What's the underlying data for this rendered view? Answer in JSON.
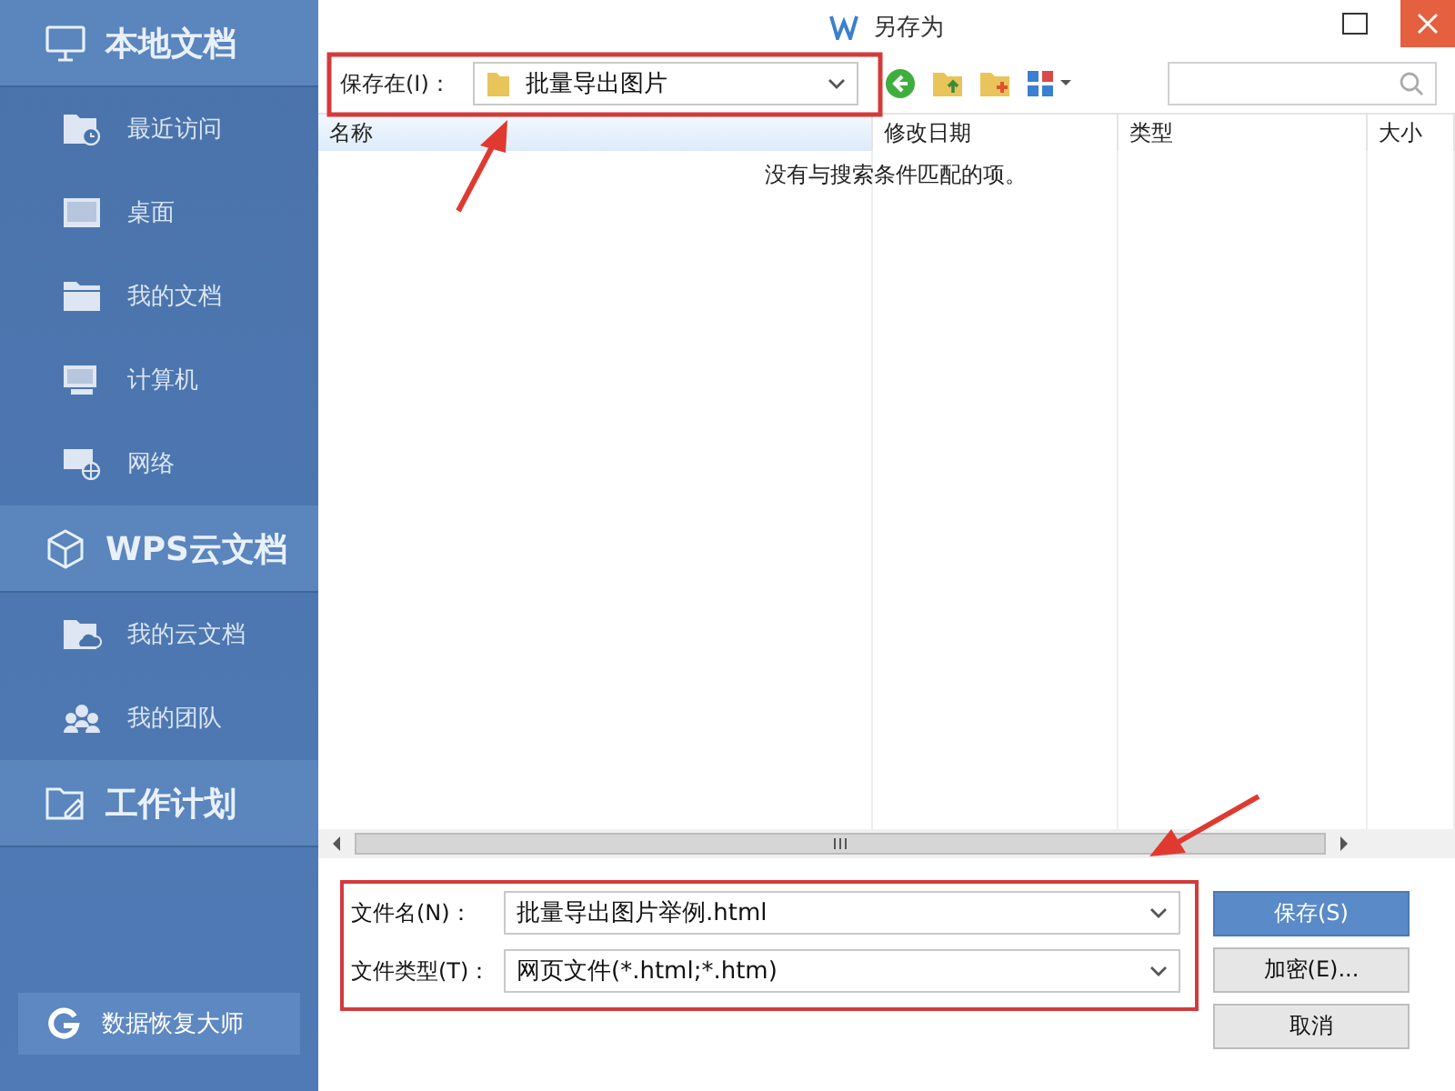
{
  "sidebar": {
    "sections": [
      {
        "title": "本地文档",
        "items": [
          {
            "label": "最近访问"
          },
          {
            "label": "桌面"
          },
          {
            "label": "我的文档"
          },
          {
            "label": "计算机"
          },
          {
            "label": "网络"
          }
        ]
      },
      {
        "title": "WPS云文档",
        "items": [
          {
            "label": "我的云文档"
          },
          {
            "label": "我的团队"
          }
        ]
      },
      {
        "title": "工作计划"
      }
    ],
    "footer_button": "数据恢复大师"
  },
  "window": {
    "title": "另存为"
  },
  "toolbar": {
    "location_label": "保存在(I)：",
    "location_value": "批量导出图片"
  },
  "table": {
    "columns": [
      "名称",
      "修改日期",
      "类型",
      "大小"
    ],
    "empty_message": "没有与搜索条件匹配的项。"
  },
  "form": {
    "fields": [
      {
        "label": "文件名(N)：",
        "value": "批量导出图片举例.html"
      },
      {
        "label": "文件类型(T)：",
        "value": "网页文件(*.html;*.htm)"
      }
    ]
  },
  "buttons": [
    {
      "label": "保存(S)",
      "kind": "primary"
    },
    {
      "label": "加密(E)...",
      "kind": "normal"
    },
    {
      "label": "取消",
      "kind": "normal"
    }
  ]
}
